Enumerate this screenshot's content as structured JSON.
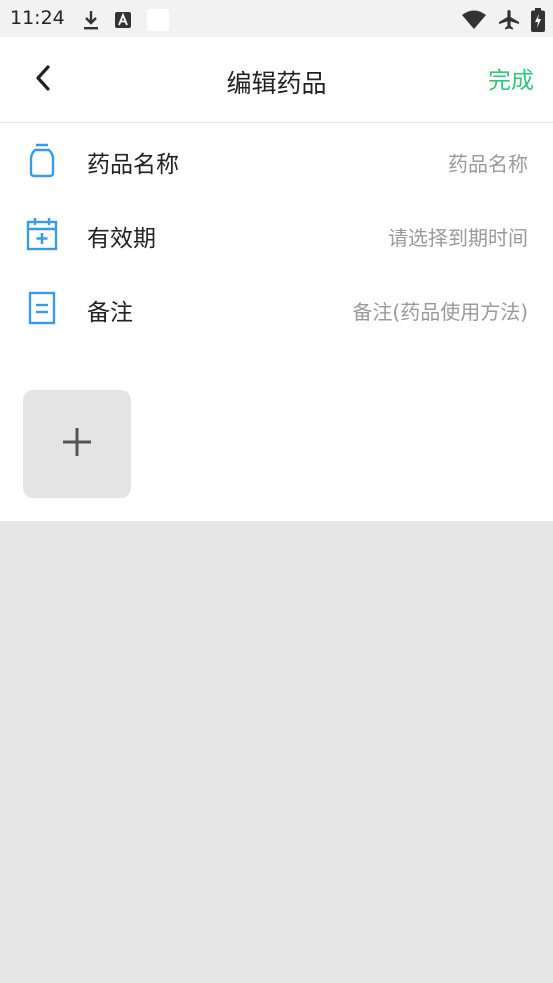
{
  "status_bar": {
    "time": "11:24",
    "left_icons": [
      "download-icon",
      "font-a-icon",
      "blank-notification-icon"
    ],
    "right_icons": [
      "wifi-icon",
      "airplane-icon",
      "battery-charging-icon"
    ]
  },
  "header": {
    "back_icon": "chevron-left-icon",
    "title": "编辑药品",
    "done_label": "完成",
    "done_color": "#2fc87a"
  },
  "form": {
    "accent_color": "#3a9be0",
    "rows": [
      {
        "icon": "medicine-bottle-icon",
        "label": "药品名称",
        "placeholder": "药品名称"
      },
      {
        "icon": "calendar-add-icon",
        "label": "有效期",
        "placeholder": "请选择到期时间"
      },
      {
        "icon": "note-icon",
        "label": "备注",
        "placeholder": "备注(药品使用方法)"
      }
    ],
    "add_photo_icon": "plus-icon"
  }
}
